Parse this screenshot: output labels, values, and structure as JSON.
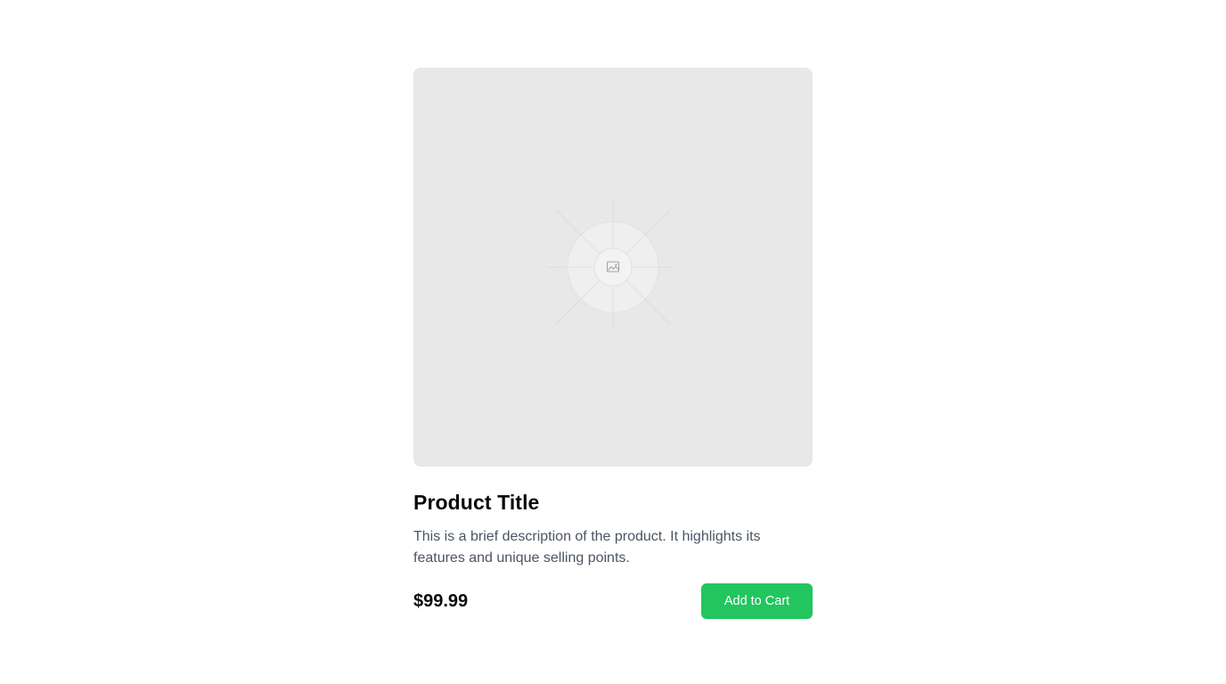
{
  "product": {
    "image_icon": "image-placeholder-icon",
    "title": "Product Title",
    "description": "This is a brief description of the product. It highlights its features and unique selling points.",
    "price": "$99.99",
    "add_to_cart_label": "Add to Cart"
  },
  "colors": {
    "accent": "#22c55e",
    "placeholder_bg": "#e8e8e8",
    "description_text": "#4b5563",
    "title_text": "#0a0a0a"
  }
}
